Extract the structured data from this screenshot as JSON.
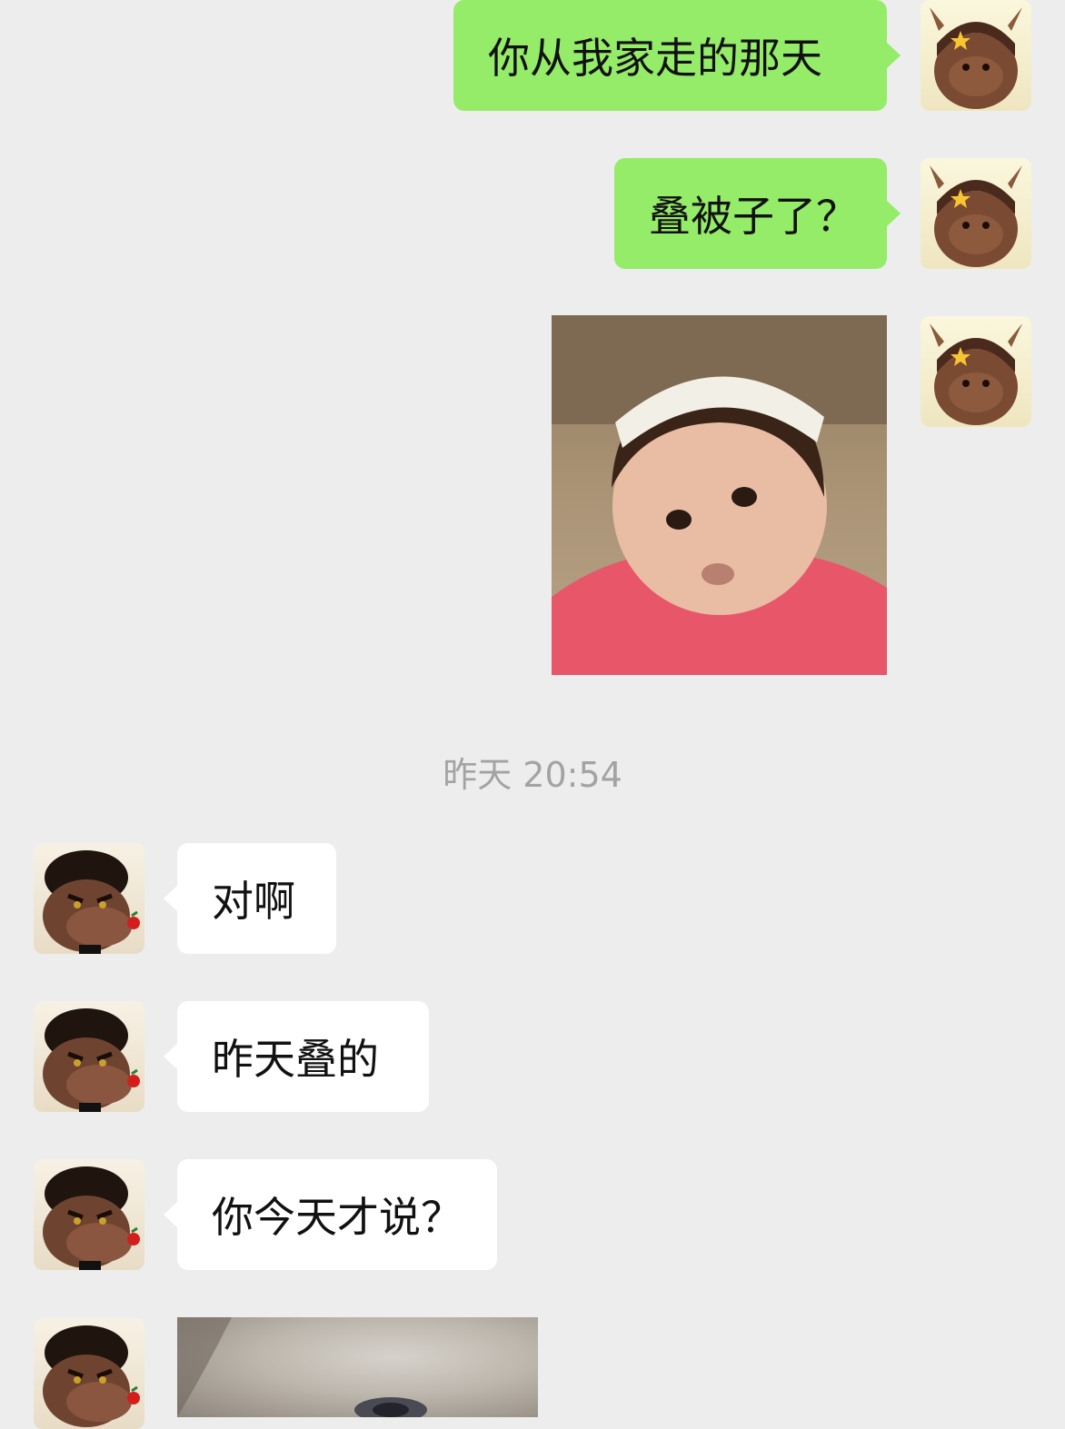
{
  "messages": [
    {
      "side": "sent",
      "type": "text",
      "text": "你从我家走的那天"
    },
    {
      "side": "sent",
      "type": "text",
      "text": "叠被子了？"
    },
    {
      "side": "sent",
      "type": "image",
      "image": "baby-sticker-image"
    },
    {
      "side": "recv",
      "type": "text",
      "text": "对啊"
    },
    {
      "side": "recv",
      "type": "text",
      "text": "昨天叠的"
    },
    {
      "side": "recv",
      "type": "text",
      "text": "你今天才说？"
    },
    {
      "side": "recv",
      "type": "image",
      "image": "cat-closeup-image"
    }
  ],
  "timestamp": "昨天 20:54",
  "avatars": {
    "self": "hippo-girl-avatar",
    "friend": "hippo-boy-avatar"
  },
  "colors": {
    "background": "#ededed",
    "sent_bubble": "#95ec69",
    "received_bubble": "#ffffff",
    "timestamp": "#a3a3a3"
  }
}
